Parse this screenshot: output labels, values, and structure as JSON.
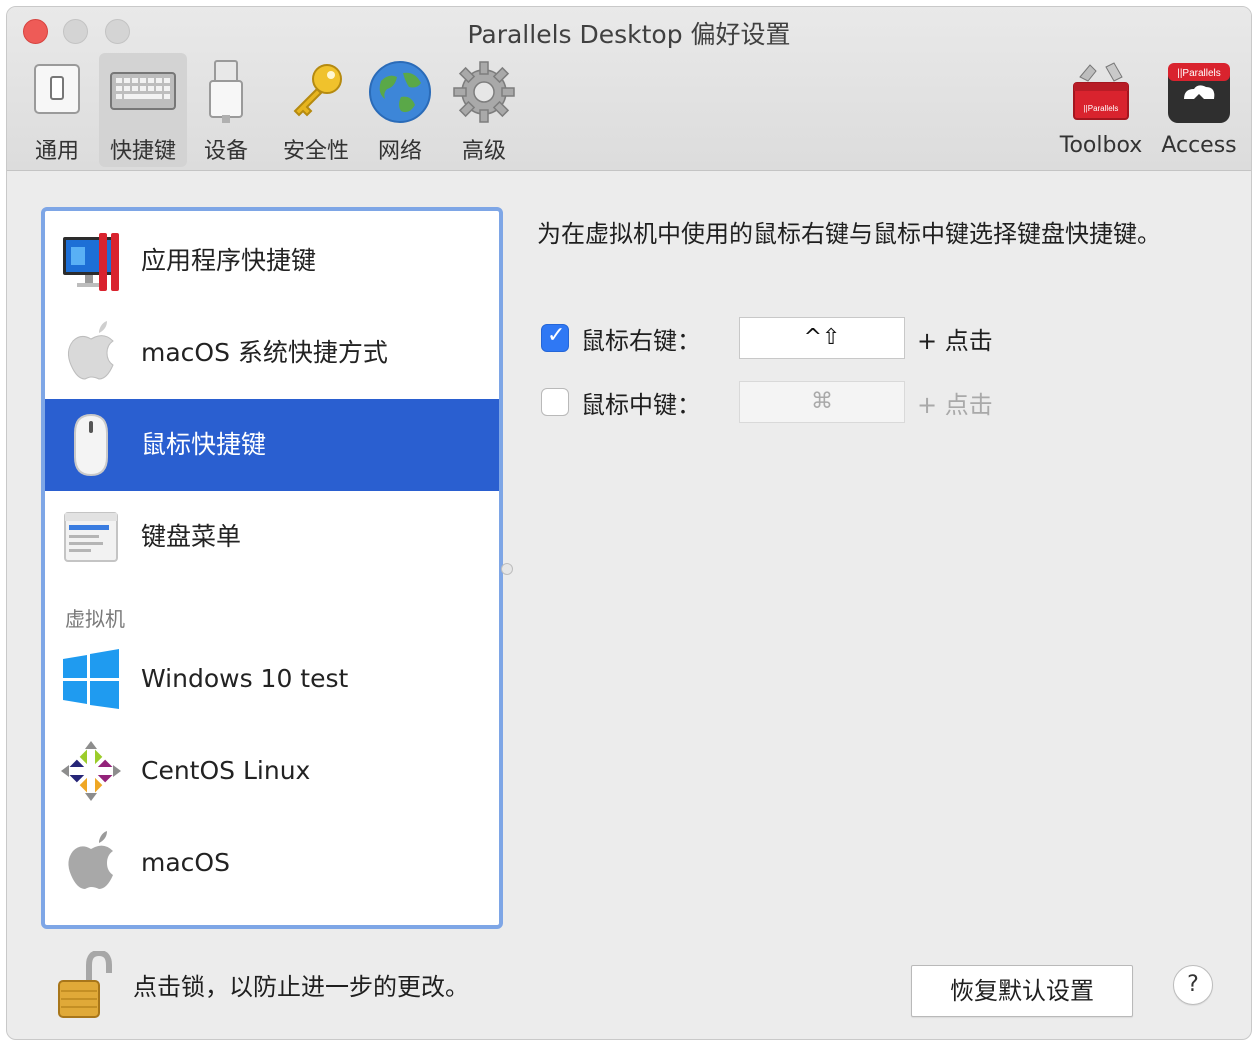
{
  "window": {
    "title": "Parallels Desktop 偏好设置"
  },
  "toolbar": {
    "items": [
      {
        "label": "通用",
        "icon": "general-icon"
      },
      {
        "label": "快捷键",
        "icon": "keyboard-icon",
        "selected": true
      },
      {
        "label": "设备",
        "icon": "usb-device-icon"
      },
      {
        "label": "安全性",
        "icon": "key-icon"
      },
      {
        "label": "网络",
        "icon": "globe-icon"
      },
      {
        "label": "高级",
        "icon": "gear-icon"
      }
    ],
    "right_items": [
      {
        "label": "Toolbox",
        "icon": "toolbox-icon",
        "badge": "||Parallels"
      },
      {
        "label": "Access",
        "icon": "access-icon",
        "badge": "||Parallels"
      }
    ]
  },
  "sidebar": {
    "items": [
      {
        "label": "应用程序快捷键",
        "icon": "parallels-app-icon"
      },
      {
        "label": "macOS 系统快捷方式",
        "icon": "apple-icon"
      },
      {
        "label": "鼠标快捷键",
        "icon": "mouse-icon",
        "selected": true
      },
      {
        "label": "键盘菜单",
        "icon": "keyboard-menu-icon"
      }
    ],
    "section_title": "虚拟机",
    "vms": [
      {
        "label": "Windows 10 test",
        "icon": "windows-icon"
      },
      {
        "label": "CentOS Linux",
        "icon": "centos-icon"
      },
      {
        "label": "macOS",
        "icon": "apple-icon"
      }
    ]
  },
  "panel": {
    "description": "为在虚拟机中使用的鼠标右键与鼠标中键选择键盘快捷键。",
    "options": [
      {
        "label": "鼠标右键：",
        "checked": true,
        "shortcut": "^⇧",
        "suffix": "+ 点击"
      },
      {
        "label": "鼠标中键：",
        "checked": false,
        "shortcut": "⌘",
        "suffix": "+ 点击"
      }
    ]
  },
  "footer": {
    "lock_text": "点击锁，以防止进一步的更改。",
    "restore_button": "恢复默认设置",
    "help_button": "?"
  },
  "colors": {
    "selection": "#2a5fd0",
    "checkbox": "#2f78f4",
    "close": "#ee5b57"
  }
}
